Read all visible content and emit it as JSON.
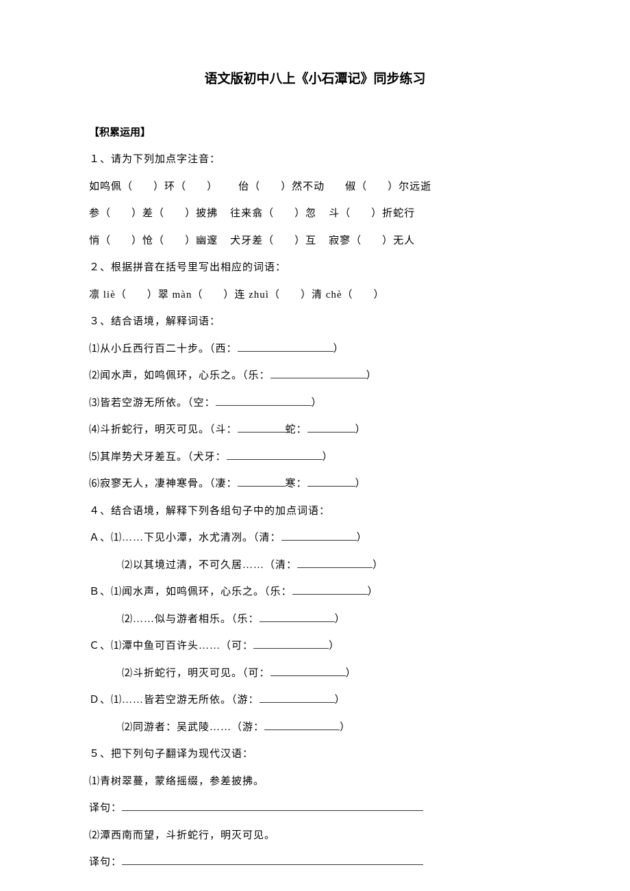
{
  "doc_title": "语文版初中八上《小石潭记》同步练习",
  "section1_header": "【积累运用】",
  "q1": {
    "prompt": "１、请为下列加点字注音：",
    "line1_a": "如鸣佩（",
    "line1_b": "）环（",
    "line1_c": "）",
    "line1_d": "佁（",
    "line1_e": "）然不动",
    "line1_f": "俶（",
    "line1_g": "）尔远逝",
    "line2_a": "参（",
    "line2_b": "）差（",
    "line2_c": "）披拂",
    "line2_d": "往来翕（",
    "line2_e": "）忽",
    "line2_f": "斗（",
    "line2_g": "）折蛇行",
    "line3_a": "悄（",
    "line3_b": "）怆（",
    "line3_c": "）幽邃",
    "line3_d": "犬牙差（",
    "line3_e": "）互",
    "line3_f": "寂寥（",
    "line3_g": "）无人"
  },
  "q2": {
    "prompt": "２、根据拼音在括号里写出相应的词语：",
    "line1_a": "凛 liè（",
    "line1_b": "）翠 màn（",
    "line1_c": "）连 zhuì（",
    "line1_d": "）清 chè（",
    "line1_e": "）"
  },
  "q3": {
    "prompt": "３、结合语境，解释词语：",
    "item1_a": "⑴从小丘西行百二十步。（西：",
    "item1_b": "）",
    "item2_a": "⑵闻水声，如鸣佩环，心乐之。（乐：",
    "item2_b": "）",
    "item3_a": "⑶皆若空游无所依。（空：",
    "item3_b": "）",
    "item4_a": "⑷斗折蛇行，明灭可见。（斗：",
    "item4_mid": "蛇：",
    "item4_b": "）",
    "item5_a": "⑸其岸势犬牙差互。（犬牙：",
    "item5_b": "）",
    "item6_a": "⑹寂寥无人，凄神寒骨。（凄：",
    "item6_mid": "寒：",
    "item6_b": "）"
  },
  "q4": {
    "prompt": "４、结合语境，解释下列各组句子中的加点词语：",
    "A1_a": "Ａ、⑴……下见小潭，水尤清冽。（清：",
    "A1_b": "）",
    "A2_a": "⑵以其境过清，不可久居……（清：",
    "A2_b": "）",
    "B1_a": "Ｂ、⑴闻水声，如鸣佩环，心乐之。（乐：",
    "B1_b": "）",
    "B2_a": "⑵……似与游者相乐。（乐：",
    "B2_b": "）",
    "C1_a": "Ｃ、⑴潭中鱼可百许头……（可：",
    "C1_b": "）",
    "C2_a": "⑵斗折蛇行，明灭可见。（可：",
    "C2_b": "）",
    "D1_a": "Ｄ、⑴……皆若空游无所依。（游：",
    "D1_b": "）",
    "D2_a": "⑵同游者：吴武陵……（游：",
    "D2_b": "）"
  },
  "q5": {
    "prompt": "５、把下列句子翻译为现代汉语：",
    "item1": "⑴青树翠蔓，蒙络摇缀，参差披拂。",
    "trans_label": "译句：",
    "item2": "⑵潭西南而望，斗折蛇行，明灭可见。"
  }
}
